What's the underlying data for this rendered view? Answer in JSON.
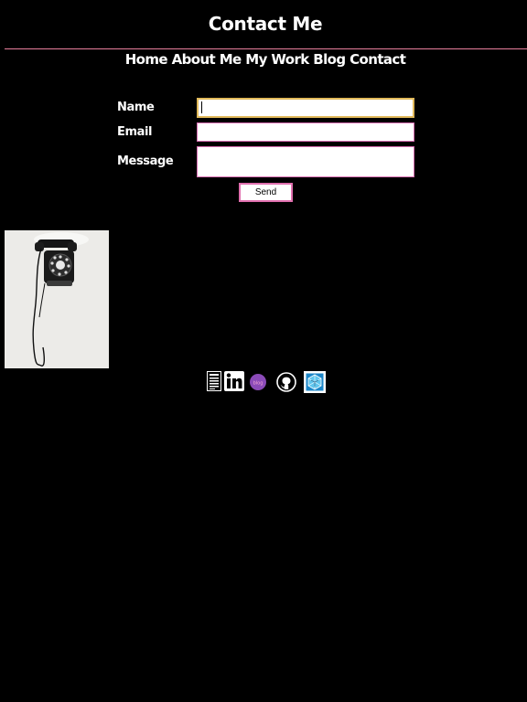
{
  "header": {
    "title": "Contact Me"
  },
  "nav": {
    "items": [
      "Home",
      "About Me",
      "My Work",
      "Blog",
      "Contact"
    ]
  },
  "form": {
    "name_label": "Name",
    "email_label": "Email",
    "message_label": "Message",
    "name_value": "",
    "email_value": "",
    "message_value": "",
    "send_label": "Send"
  },
  "photo": {
    "description_icon": "rotary-telephone-photo"
  },
  "socials": {
    "icons": [
      "resume-icon",
      "linkedin-icon",
      "blog-badge-icon",
      "github-icon",
      "codepen-cube-icon"
    ],
    "blog_badge_text": "blog"
  },
  "colors": {
    "background": "#000000",
    "text": "#ffffff",
    "accent_pink": "#e87f9c",
    "field_border": "#d96fb3",
    "focus_border": "#e1b95a"
  }
}
